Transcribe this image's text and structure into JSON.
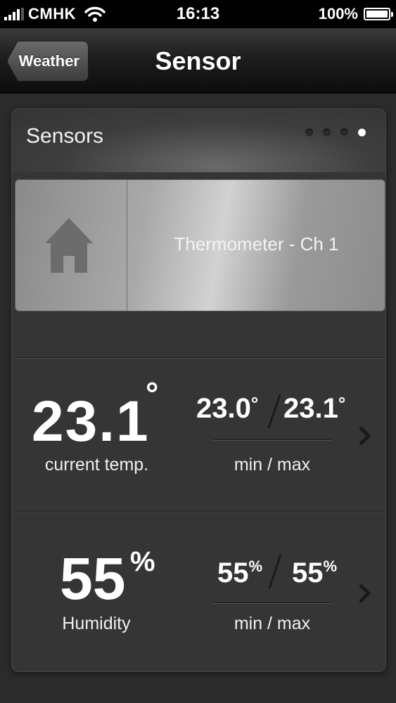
{
  "status_bar": {
    "carrier": "CMHK",
    "time": "16:13",
    "battery": "100%",
    "battery_level": 1.0,
    "signal_bars": 4
  },
  "nav": {
    "back_label": "Weather",
    "title": "Sensor"
  },
  "card": {
    "title": "Sensors",
    "page_dots": 4,
    "active_dot": 3,
    "sensor_name": "Thermometer - Ch 1",
    "sensor_icon": "home-icon"
  },
  "temperature": {
    "current": "23.1",
    "unit": "°",
    "current_label": "current temp.",
    "min": "23.0",
    "max": "23.1",
    "min_unit": "°",
    "max_unit": "°",
    "minmax_label": "min / max"
  },
  "humidity": {
    "current": "55",
    "unit": "%",
    "current_label": "Humidity",
    "min": "55",
    "max": "55",
    "min_unit": "%",
    "max_unit": "%",
    "minmax_label": "min / max"
  },
  "colors": {
    "background": "#2b2b2b",
    "card": "#353535",
    "text": "#ffffff"
  }
}
